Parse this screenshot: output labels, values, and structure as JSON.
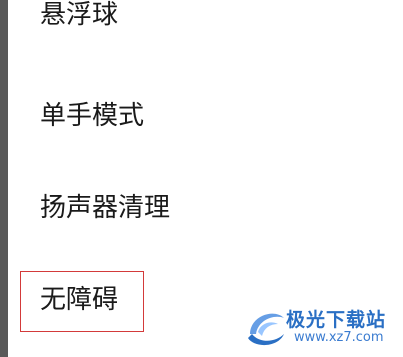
{
  "settings": {
    "items": [
      {
        "label": "悬浮球"
      },
      {
        "label": "单手模式"
      },
      {
        "label": "扬声器清理"
      },
      {
        "label": "无障碍"
      }
    ],
    "highlighted_item": "无障碍"
  },
  "watermark": {
    "name": "极光下载站",
    "url": "www.xz7.com",
    "logo_icon": "aurora-swirl-logo"
  },
  "colors": {
    "highlight_border": "#d33a3a",
    "watermark_blue": "#2a6fc4",
    "left_edge": "#595959"
  }
}
